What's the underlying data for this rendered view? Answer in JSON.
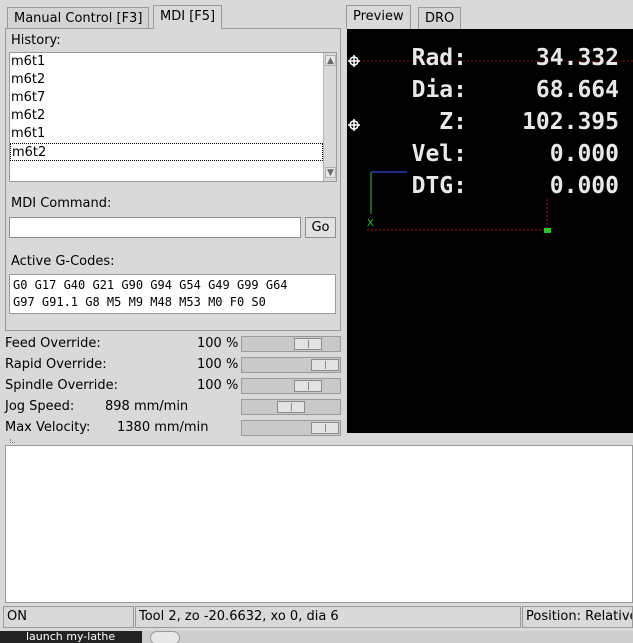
{
  "left_tabs": [
    {
      "label": "Manual Control [F3]"
    },
    {
      "label": "MDI [F5]"
    }
  ],
  "right_tabs": [
    {
      "label": "Preview"
    },
    {
      "label": "DRO"
    }
  ],
  "mdi": {
    "history_label": "History:",
    "history": [
      "m6t1",
      "m6t2",
      "m6t7",
      "m6t2",
      "m6t1",
      "m6t2"
    ],
    "selected_index": 5,
    "command_label": "MDI Command:",
    "command_value": "",
    "go_label": "Go",
    "active_gcodes_label": "Active G-Codes:",
    "active_gcodes_line1": "G0 G17 G40 G21 G90 G94 G54 G49 G99 G64",
    "active_gcodes_line2": "G97 G91.1 G8 M5 M9 M48 M53 M0 F0 S0"
  },
  "overrides": [
    {
      "label": "Feed Override:",
      "value": "100 %",
      "level": 0.75
    },
    {
      "label": "Rapid Override:",
      "value": "100 %",
      "level": 1.0
    },
    {
      "label": "Spindle Override:",
      "value": "100 %",
      "level": 0.75
    },
    {
      "label": "Jog Speed:",
      "value": "898 mm/min",
      "level": 0.5
    },
    {
      "label": "Max Velocity:",
      "value": "1380 mm/min",
      "level": 1.0
    }
  ],
  "dro": [
    {
      "axis": "Rad:",
      "value": "34.332"
    },
    {
      "axis": "Dia:",
      "value": "68.664"
    },
    {
      "axis": "Z:",
      "value": "102.395"
    },
    {
      "axis": "Vel:",
      "value": "0.000"
    },
    {
      "axis": "DTG:",
      "value": "0.000"
    }
  ],
  "preview_axis_label": "X",
  "status": {
    "state": "ON",
    "tool": "Tool 2, zo -20.6632, xo 0, dia 6",
    "position": "Position: Relative"
  },
  "taskbar": {
    "launch_label": "launch my-lathe"
  },
  "colors": {
    "preview_bg": "#000000",
    "dro_text": "#e8e8e8",
    "axis_green": "#2fbf2f",
    "limit_red": "#b01010"
  }
}
